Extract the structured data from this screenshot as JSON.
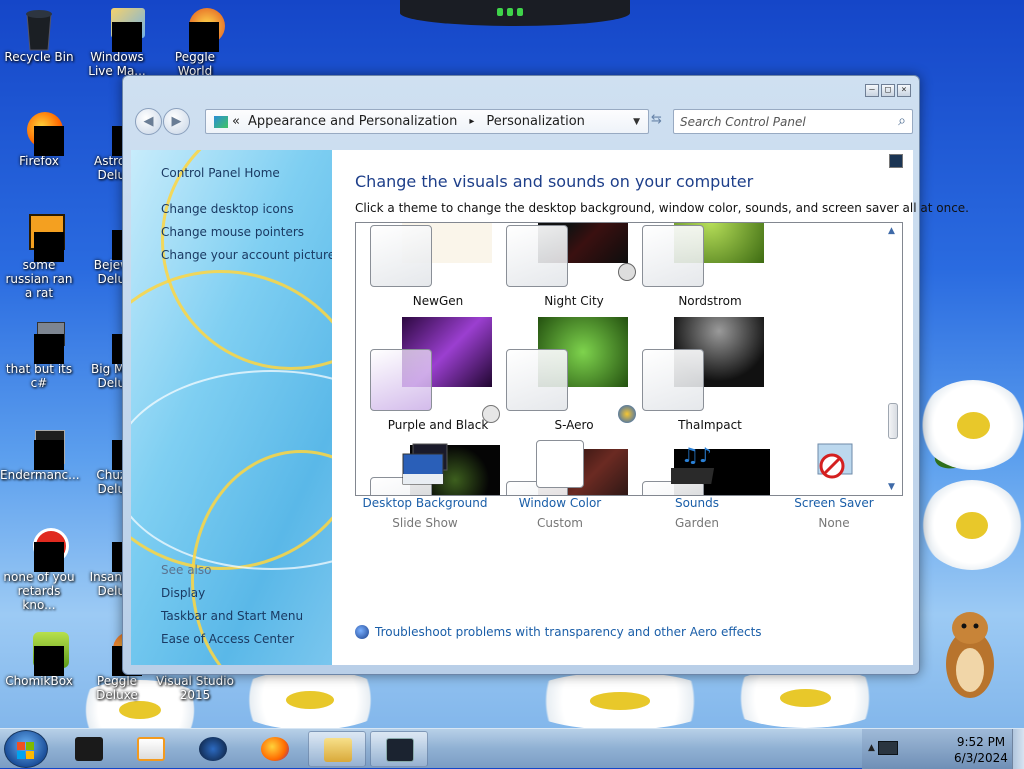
{
  "desktop": {
    "icons": [
      {
        "label": "Recycle Bin"
      },
      {
        "label": "Windows Live Ma..."
      },
      {
        "label": "Peggle World"
      },
      {
        "label": "Firefox"
      },
      {
        "label": "Astrol... Delu..."
      },
      {
        "label": "some russian ran a rat"
      },
      {
        "label": "Bejew... Delu..."
      },
      {
        "label": "that but its c#"
      },
      {
        "label": "Big Mo... Delu..."
      },
      {
        "label": "Endermanc..."
      },
      {
        "label": "Chuz... Delu..."
      },
      {
        "label": "none of you retards kno..."
      },
      {
        "label": "Insaniq... Delu..."
      },
      {
        "label": "ChomikBox"
      },
      {
        "label": "Peggle Deluxe"
      },
      {
        "label": "Visual Studio 2015"
      }
    ]
  },
  "window": {
    "controls": {
      "minimize": "–",
      "maximize": "□",
      "close": "×"
    },
    "nav": {
      "back": "◀",
      "forward": "▶"
    },
    "breadcrumb": {
      "chevrons": "«",
      "part1": "Appearance and Personalization",
      "sep": "▸",
      "part2": "Personalization"
    },
    "search_placeholder": "Search Control Panel",
    "sidebar": {
      "home": "Control Panel Home",
      "links": [
        "Change desktop icons",
        "Change mouse pointers",
        "Change your account picture"
      ],
      "see_also": "See also",
      "see_also_links": [
        "Display",
        "Taskbar and Start Menu",
        "Ease of Access Center"
      ]
    },
    "content": {
      "title": "Change the visuals and sounds on your computer",
      "subtitle": "Click a theme to change the desktop background, window color, sounds, and screen saver all at once.",
      "themes": [
        {
          "name": "NewGen"
        },
        {
          "name": "Night City"
        },
        {
          "name": "Nordstrom"
        },
        {
          "name": "Purple and Black"
        },
        {
          "name": "S-Aero"
        },
        {
          "name": "ThaImpact"
        },
        {
          "name": ""
        },
        {
          "name": ""
        },
        {
          "name": ""
        }
      ],
      "bottom": [
        {
          "title": "Desktop Background",
          "value": "Slide Show"
        },
        {
          "title": "Window Color",
          "value": "Custom"
        },
        {
          "title": "Sounds",
          "value": "Garden"
        },
        {
          "title": "Screen Saver",
          "value": "None"
        }
      ],
      "troubleshoot": "Troubleshoot problems with transparency and other Aero effects"
    }
  },
  "taskbar": {
    "clock_time": "9:52 PM",
    "clock_date": "6/3/2024"
  },
  "colors": {
    "link": "#1a5ea8",
    "heading": "#1e3f8a",
    "desktop": "#2a6be0"
  }
}
